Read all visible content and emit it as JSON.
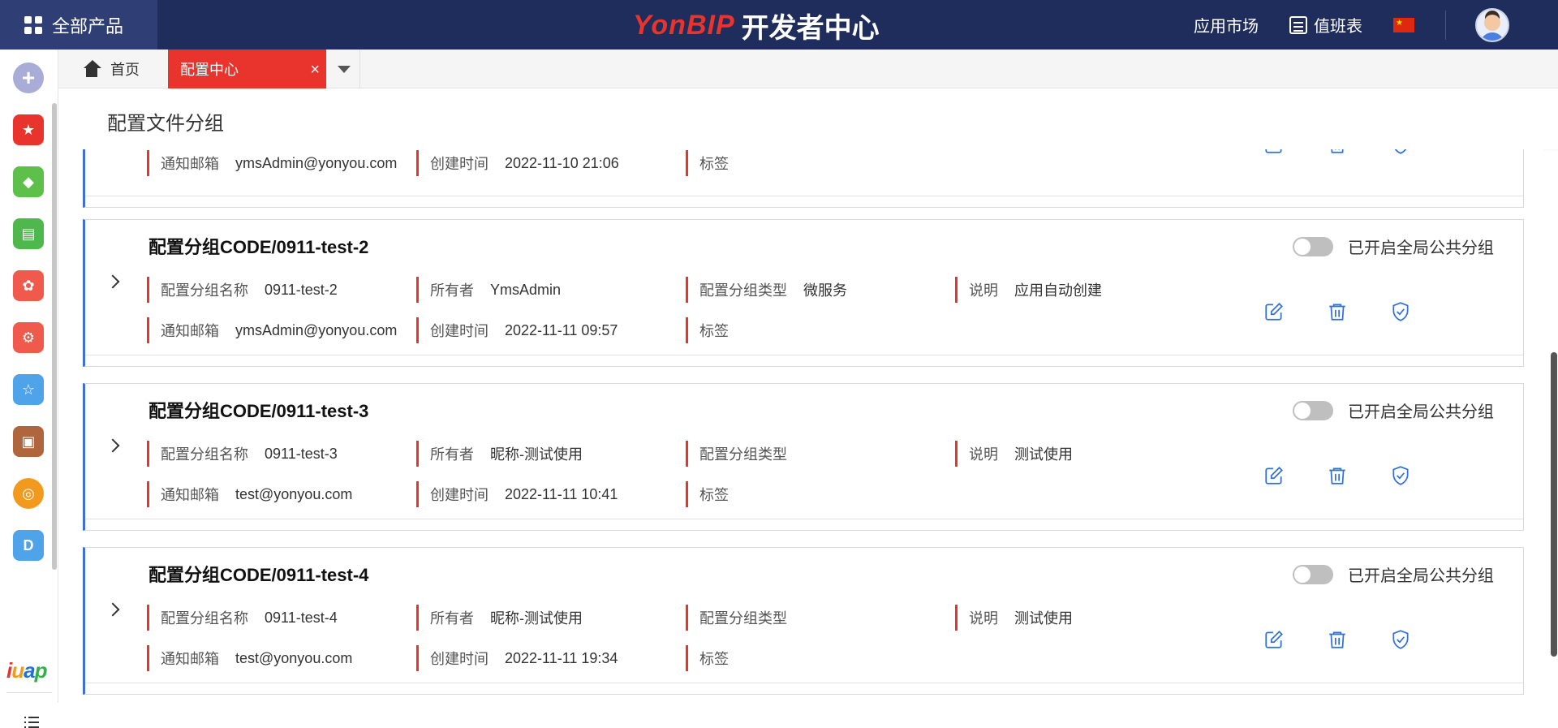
{
  "header": {
    "all_products": "全部产品",
    "brand_yon": "YonBIP",
    "brand_center": "开发者中心",
    "app_market": "应用市场",
    "duty_table": "值班表",
    "flag_icon": "china-flag-icon",
    "colors": {
      "topbar": "#1f2d5c",
      "accent": "#e8342c",
      "primary_blue": "#3f6fd8"
    }
  },
  "sidebar": {
    "items": [
      {
        "icon": "add-circle-icon",
        "color": "#a8acd6"
      },
      {
        "icon": "star-folder-icon",
        "color": "#e8342c"
      },
      {
        "icon": "cube-icon",
        "color": "#5cc04a"
      },
      {
        "icon": "document-icon",
        "color": "#4fb84c"
      },
      {
        "icon": "network-icon",
        "color": "#ef5a4c"
      },
      {
        "icon": "settings-icon",
        "color": "#ef5a4c"
      },
      {
        "icon": "star-window-icon",
        "color": "#4fa3e8"
      },
      {
        "icon": "package-settings-icon",
        "color": "#b0663d"
      },
      {
        "icon": "target-icon",
        "color": "#f29a1e"
      },
      {
        "icon": "d-code-icon",
        "color": "#4fa3e8"
      }
    ],
    "logo_text": "iuap"
  },
  "tabs": {
    "home_label": "首页",
    "active_label": "配置中心",
    "close_symbol": "×"
  },
  "page": {
    "title": "配置文件分组"
  },
  "labels": {
    "name": "配置分组名称",
    "owner": "所有者",
    "type": "配置分组类型",
    "desc": "说明",
    "email": "通知邮箱",
    "created": "创建时间",
    "tags": "标签",
    "global_toggle": "已开启全局公共分组"
  },
  "partial_card": {
    "email": "ymsAdmin@yonyou.com",
    "created": "2022-11-10 21:06"
  },
  "cards": [
    {
      "title": "配置分组CODE/0911-test-2",
      "name": "0911-test-2",
      "owner": "YmsAdmin",
      "type": "微服务",
      "desc": "应用自动创建",
      "email": "ymsAdmin@yonyou.com",
      "created": "2022-11-11 09:57",
      "global_enabled": false
    },
    {
      "title": "配置分组CODE/0911-test-3",
      "name": "0911-test-3",
      "owner": "昵称-测试使用",
      "type": "",
      "desc": "测试使用",
      "email": "test@yonyou.com",
      "created": "2022-11-11 10:41",
      "global_enabled": false
    },
    {
      "title": "配置分组CODE/0911-test-4",
      "name": "0911-test-4",
      "owner": "昵称-测试使用",
      "type": "",
      "desc": "测试使用",
      "email": "test@yonyou.com",
      "created": "2022-11-11 19:34",
      "global_enabled": false
    }
  ]
}
